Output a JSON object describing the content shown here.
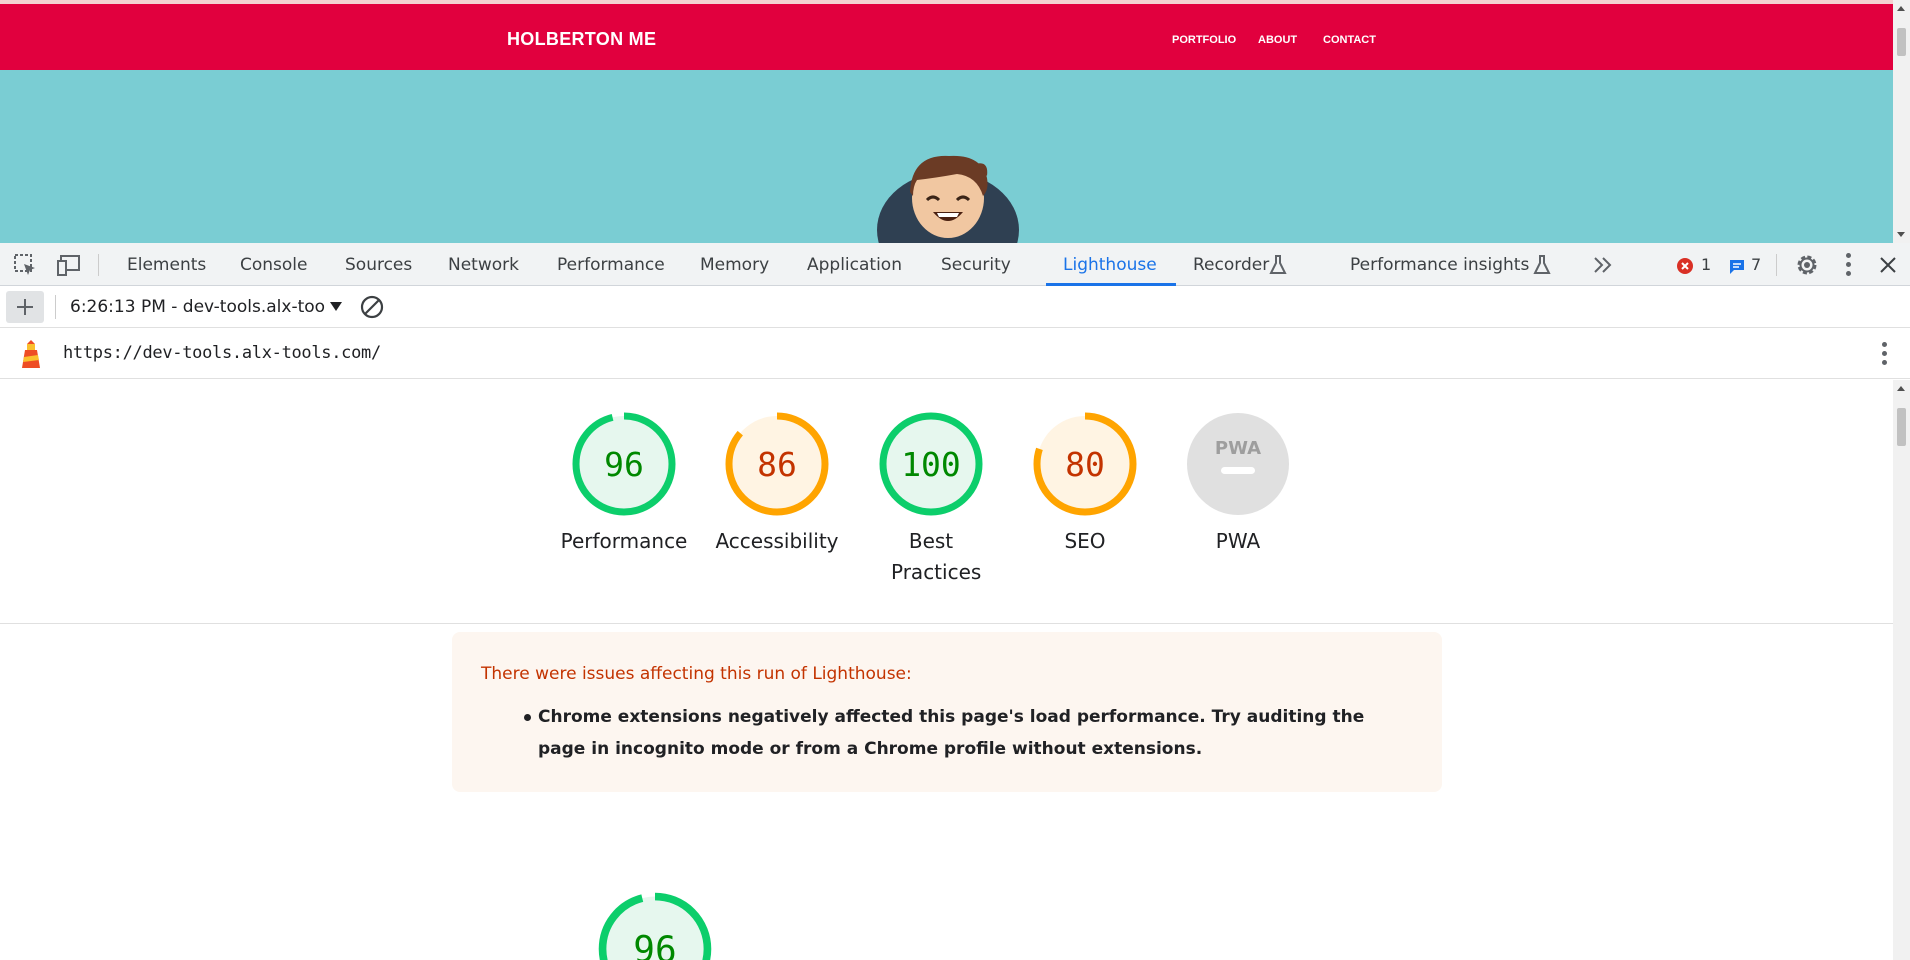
{
  "website": {
    "logo": "HOLBERTON ME",
    "nav": [
      "PORTFOLIO",
      "ABOUT",
      "CONTACT"
    ]
  },
  "devtools": {
    "tabs": [
      "Elements",
      "Console",
      "Sources",
      "Network",
      "Performance",
      "Memory",
      "Application",
      "Security",
      "Lighthouse",
      "Recorder",
      "Performance insights"
    ],
    "active_tab": "Lighthouse",
    "error_count": "1",
    "message_count": "7"
  },
  "lighthouse": {
    "report_select": "6:26:13 PM - dev-tools.alx-too",
    "url": "https://dev-tools.alx-tools.com/",
    "scores": [
      {
        "label": "Performance",
        "value": "96",
        "fraction": 0.96
      },
      {
        "label": "Accessibility",
        "value": "86",
        "fraction": 0.86
      },
      {
        "label": "Best Practices",
        "value": "100",
        "fraction": 1.0
      },
      {
        "label": "SEO",
        "value": "80",
        "fraction": 0.8
      },
      {
        "label": "PWA",
        "value": "PWA",
        "fraction": 0
      }
    ],
    "warning_title": "There were issues affecting this run of Lighthouse:",
    "warning_item": "Chrome extensions negatively affected this page's load performance. Try auditing the page in incognito mode or from a Chrome profile without extensions.",
    "performance_gauge_value": "96"
  },
  "colors": {
    "header_red": "#e1003e",
    "hero_teal": "#7acdd3",
    "pass_green": "#0cce6b",
    "pass_text": "#008800",
    "average_orange": "#ffa400",
    "average_text": "#c33300",
    "devtools_blue": "#1a73e8"
  }
}
